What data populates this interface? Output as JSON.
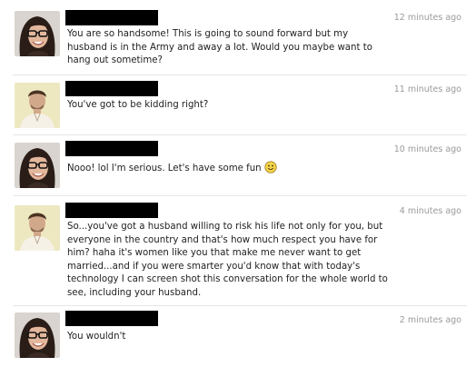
{
  "conversation": {
    "messages": [
      {
        "sender": "woman",
        "time": "12 minutes ago",
        "text": "You are so handsome! This is going to sound forward but my husband is in the Army and away a lot. Would you maybe want to hang out sometime?"
      },
      {
        "sender": "man",
        "time": "11 minutes ago",
        "text": "You've got to be kidding right?"
      },
      {
        "sender": "woman",
        "time": "10 minutes ago",
        "text": "Nooo! lol I'm serious. Let's have some fun",
        "emoticon": "smiley-face-icon"
      },
      {
        "sender": "man",
        "time": "4 minutes ago",
        "text": "So...you've got a husband willing to risk his life not only for you, but everyone in the country and that's how much respect you have for him? haha it's women like you that make me never want to get married...and if you were smarter you'd know that with today's technology I can screen shot this conversation for the whole world to see, including your husband."
      },
      {
        "sender": "woman",
        "time": "2 minutes ago",
        "text": "You wouldn't"
      }
    ]
  },
  "colors": {
    "redaction": "#000000",
    "timestamp": "#9a9a9a",
    "message_text": "#222222",
    "divider": "#e6e6e6",
    "smiley_fill": "#f5d44a"
  }
}
